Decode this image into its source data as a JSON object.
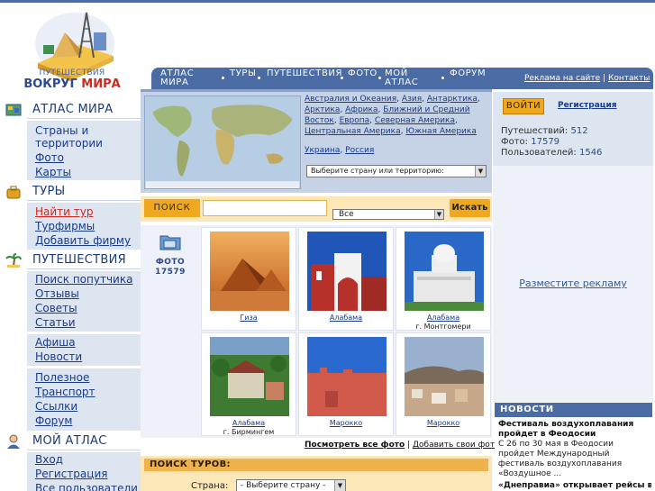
{
  "logo": {
    "line1": "ПУТЕШЕСТВИЯ",
    "line2_a": "ВОКРУГ ",
    "line2_b": "МИРА"
  },
  "nav": {
    "items": [
      {
        "label": "АТЛАС МИРА"
      },
      {
        "label": "ТУРЫ"
      },
      {
        "label": "ПУТЕШЕСТВИЯ"
      },
      {
        "label": "ФОТО"
      },
      {
        "label": "МОЙ АТЛАС"
      },
      {
        "label": "ФОРУМ"
      }
    ],
    "ads_link": "Реклама на сайте",
    "separator": "|",
    "contacts_link": "Контакты"
  },
  "sidebar": {
    "atlas": {
      "title": "АТЛАС МИРА",
      "links": [
        "Страны и территории",
        "Фото",
        "Карты"
      ]
    },
    "tours": {
      "title": "ТУРЫ",
      "links": [
        "Найти тур",
        "Турфирмы",
        "Добавить фирму"
      ]
    },
    "travel": {
      "title": "ПУТЕШЕСТВИЯ",
      "links": [
        "Поиск попутчика",
        "Отзывы",
        "Советы",
        "Статьи",
        "Афиша",
        "Новости",
        "Полезное",
        "Транспорт",
        "Ссылки",
        "Форум"
      ]
    },
    "my_atlas": {
      "title": "МОЙ АТЛАС",
      "links": [
        "Вход",
        "Регистрация",
        "Все пользователи"
      ]
    }
  },
  "regions": {
    "links": [
      "Австралия и Океания",
      "Азия",
      "Антарктика",
      "Арктика",
      "Африка",
      "Ближний и Средний Восток",
      "Европа",
      "Северная Америка",
      "Центральная Америка",
      "Южная Америка"
    ],
    "extra": [
      "Украина",
      "Россия"
    ],
    "select_placeholder": "Выберите страну или территорию:"
  },
  "search": {
    "label": "ПОИСК",
    "input_value": "",
    "scope": "Все",
    "button": "Искать"
  },
  "photos": {
    "count_label": "ФОТО",
    "count": "17579",
    "items": [
      {
        "caption": "Гиза",
        "sub": ""
      },
      {
        "caption": "Алабама",
        "sub": ""
      },
      {
        "caption": "Алабама",
        "sub": "г. Монтгомери"
      },
      {
        "caption": "Алабама",
        "sub": "г. Бирмингем"
      },
      {
        "caption": "Марокко",
        "sub": ""
      },
      {
        "caption": "Марокко",
        "sub": ""
      }
    ],
    "view_all": "Посмотреть все фото",
    "separator": "|",
    "add": "Добавить свои фото"
  },
  "tour_search": {
    "title": "ПОИСК ТУРОВ:",
    "country_label": "Страна:",
    "country_value": "- Выберите страну -"
  },
  "user_panel": {
    "login": "ВОЙТИ",
    "register": "Регистрация",
    "stats": [
      {
        "label": "Путешествий:",
        "value": "512"
      },
      {
        "label": "Фото:",
        "value": "17579"
      },
      {
        "label": "Пользователей:",
        "value": "1546"
      }
    ]
  },
  "ad": {
    "text": "Разместите рекламу"
  },
  "news": {
    "title": "НОВОСТИ",
    "item1_title": "Фестиваль воздухоплавания пройдет в Феодосии",
    "item1_text": "С 26 по 30 мая в Феодосии пройдет Международный фестиваль воздухоплавания «Воздушное ...",
    "item2_title": "«Днеправиа» открывает рейсы в"
  },
  "colors": {
    "nav": "#4a6ba3",
    "accent_orange": "#f0a91e",
    "sidebar_bg": "#dde5f1",
    "link": "#1a3b8a",
    "red": "#d0271b"
  }
}
